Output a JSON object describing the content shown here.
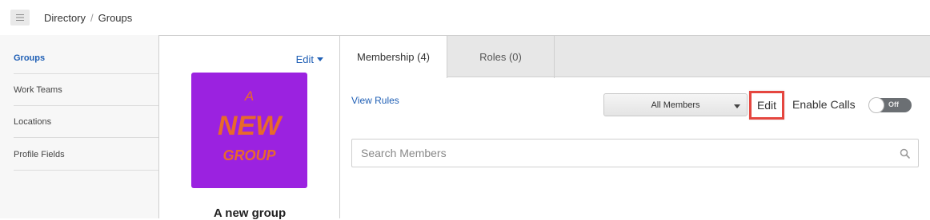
{
  "breadcrumb": {
    "root": "Directory",
    "separator": "/",
    "current": "Groups"
  },
  "sidebar": {
    "items": [
      {
        "label": "Groups",
        "active": true
      },
      {
        "label": "Work Teams",
        "active": false
      },
      {
        "label": "Locations",
        "active": false
      },
      {
        "label": "Profile Fields",
        "active": false
      }
    ]
  },
  "profile": {
    "edit_label": "Edit",
    "image": {
      "line1": "A",
      "line2": "NEW",
      "line3": "GROUP",
      "bg_color": "#9b22e0",
      "text_color": "#e8692b"
    },
    "group_name": "A new group"
  },
  "tabs": [
    {
      "label": "Membership (4)",
      "active": true
    },
    {
      "label": "Roles (0)",
      "active": false
    }
  ],
  "membership": {
    "view_rules": "View Rules",
    "filter": {
      "selected": "All Members"
    },
    "edit_label": "Edit",
    "enable_calls_label": "Enable Calls",
    "toggle_state": "Off",
    "search": {
      "placeholder": "Search Members",
      "value": ""
    }
  },
  "colors": {
    "link": "#1f5fb5",
    "highlight": "#e5463f",
    "toggle_off": "#6b6f73"
  }
}
